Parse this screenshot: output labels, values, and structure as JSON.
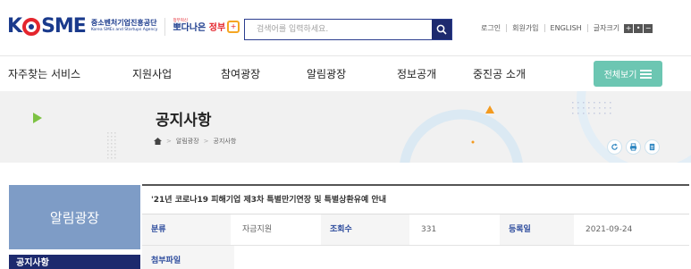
{
  "header": {
    "logo_word_left": "K",
    "logo_word_right": "SME",
    "logo_sub_kr": "중소벤처기업진흥공단",
    "logo_sub_en": "Korea SMEs and Startups Agency",
    "gov_small": "정부혁신",
    "gov_big_a": "뽀다나은",
    "gov_big_b": "정부",
    "search_placeholder": "검색어를 입력하세요.",
    "util_links": [
      "로그인",
      "회원가입",
      "ENGLISH",
      "글자크기"
    ],
    "font_controls": [
      "+",
      "•",
      "−"
    ]
  },
  "nav": {
    "items": [
      "자주찾는 서비스",
      "지원사업",
      "참여광장",
      "알림광장",
      "정보공개",
      "중진공 소개"
    ],
    "all_label": "전체보기"
  },
  "banner": {
    "title": "공지사항",
    "breadcrumb": [
      "알림광장",
      "공지사항"
    ]
  },
  "sidebar": {
    "heading": "알림광장",
    "active_item": "공지사항"
  },
  "notice": {
    "title": "'21년 코로나19 피해기업 제3차 특별만기연장 및 특별상환유예 안내",
    "category_label": "분류",
    "category_value": "자금지원",
    "views_label": "조회수",
    "views_value": "331",
    "date_label": "등록일",
    "date_value": "2021-09-24",
    "attachment_label": "첨부파일"
  },
  "colors": {
    "brand_navy": "#1d2a6e",
    "brand_red": "#e4252d",
    "accent_mint": "#6cc6b2",
    "sidebar_blue": "#7e9cc6",
    "banner_bg": "#f1f1f1"
  },
  "icons": [
    "search-icon",
    "hamburger-icon",
    "home-icon",
    "refresh-icon",
    "print-icon",
    "document-icon"
  ]
}
